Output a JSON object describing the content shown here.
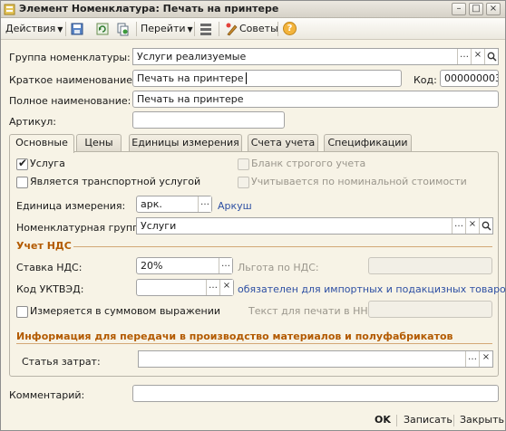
{
  "window": {
    "title": "Элемент Номенклатура: Печать на принтере",
    "minimize": "–",
    "maximize": "□",
    "close": "×"
  },
  "toolbar": {
    "actions_label": "Действия",
    "goto_label": "Перейти",
    "advice_label": "Советы",
    "help_glyph": "?"
  },
  "header": {
    "group_label": "Группа номенклатуры:",
    "group_value": "Услуги реализуемые",
    "short_name_label": "Краткое наименование:",
    "short_name_value": "Печать на принтере",
    "code_label": "Код:",
    "code_value": "000000003",
    "full_name_label": "Полное наименование:",
    "full_name_value": "Печать на принтере",
    "article_label": "Артикул:",
    "article_value": ""
  },
  "tabs": [
    {
      "label": "Основные"
    },
    {
      "label": "Цены"
    },
    {
      "label": "Единицы измерения"
    },
    {
      "label": "Счета учета"
    },
    {
      "label": "Спецификации"
    }
  ],
  "main": {
    "service_label": "Услуга",
    "service_checked": true,
    "transport_label": "Является транспортной услугой",
    "strict_form_label": "Бланк строгого учета",
    "nominal_label": "Учитывается по номинальной стоимости",
    "unit_label": "Единица измерения:",
    "unit_value": "арк.",
    "unit_link": "Аркуш",
    "nom_group_label": "Номенклатурная группа:",
    "nom_group_value": "Услуги",
    "vat_section": "Учет НДС",
    "vat_rate_label": "Ставка НДС:",
    "vat_rate_value": "20%",
    "vat_benefit_label": "Льгота по НДС:",
    "uktzed_label": "Код УКТВЭД:",
    "uktzed_value": "",
    "uktzed_link": "обязателен для импортных и подакцизных товаров",
    "sum_measure_label": "Измеряется в суммовом выражении",
    "print_text_label": "Текст для печати в НН:",
    "production_section": "Информация для передачи в производство материалов и полуфабрикатов",
    "cost_item_label": "Статья затрат:",
    "cost_item_value": ""
  },
  "footer": {
    "comment_label": "Комментарий:",
    "comment_value": "",
    "ok_label": "OK",
    "save_label": "Записать",
    "close_label": "Закрыть"
  }
}
